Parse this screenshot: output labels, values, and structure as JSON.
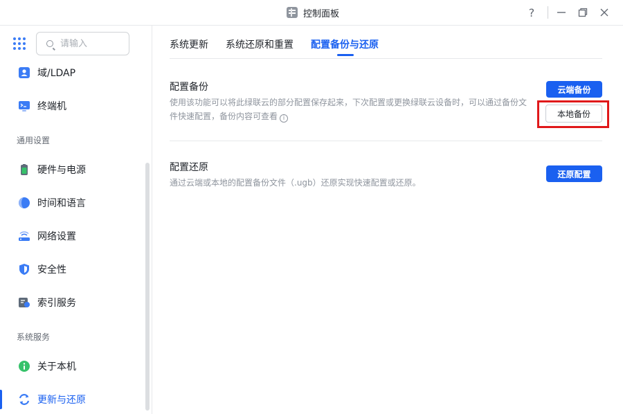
{
  "window": {
    "title": "控制面板",
    "icon": "control-panel-icon",
    "controls": [
      "help-icon",
      "minimize-icon",
      "restore-icon",
      "close-icon"
    ]
  },
  "sidebar": {
    "search_placeholder": "请输入",
    "items_top": [
      {
        "label": "域/LDAP",
        "icon": "domain-ldap-icon"
      },
      {
        "label": "终端机",
        "icon": "terminal-icon"
      }
    ],
    "section_general": "通用设置",
    "items_general": [
      {
        "label": "硬件与电源",
        "icon": "hardware-power-icon"
      },
      {
        "label": "时间和语言",
        "icon": "time-language-icon"
      },
      {
        "label": "网络设置",
        "icon": "network-icon"
      },
      {
        "label": "安全性",
        "icon": "security-shield-icon"
      },
      {
        "label": "索引服务",
        "icon": "index-service-icon"
      }
    ],
    "section_system": "系统服务",
    "items_system": [
      {
        "label": "关于本机",
        "icon": "about-info-icon"
      },
      {
        "label": "更新与还原",
        "icon": "update-restore-icon",
        "active": true
      }
    ]
  },
  "tabs": [
    {
      "label": "系统更新"
    },
    {
      "label": "系统还原和重置"
    },
    {
      "label": "配置备份与还原",
      "active": true
    }
  ],
  "backup": {
    "title": "配置备份",
    "desc_line1": "使用该功能可以将此绿联云的部分配置保存起来，下次配置或更换绿联云设备时，可以通过备份文",
    "desc_line2": "件快速配置，备份内容可查看",
    "cloud_button": "云端备份",
    "local_button": "本地备份"
  },
  "restore": {
    "title": "配置还原",
    "desc": "通过云端或本地的配置备份文件（.ugb）还原实现快速配置或还原。",
    "button": "还原配置"
  },
  "colors": {
    "accent": "#1a60f0",
    "highlight": "#e0181a"
  }
}
